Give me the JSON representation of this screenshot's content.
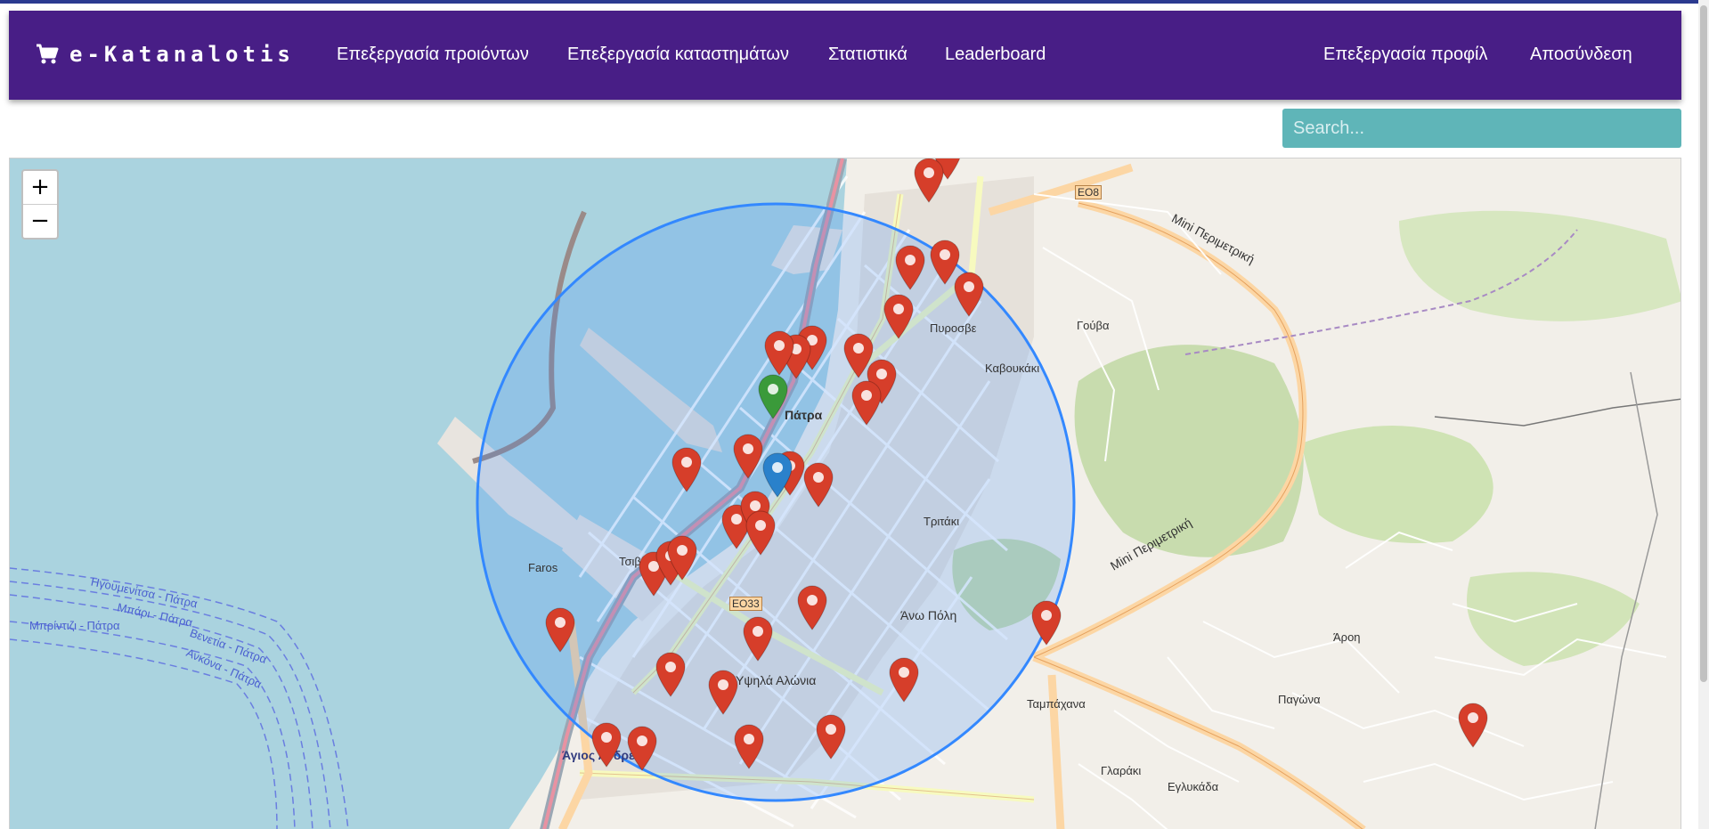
{
  "navbar": {
    "brand": "e-Katanalotis",
    "links": [
      "Επεξεργασία προιόντων",
      "Επεξεργασία καταστημάτων",
      "Στατιστικά",
      "Leaderboard"
    ],
    "right_links": [
      "Επεξεργασία προφίλ",
      "Αποσύνδεση"
    ],
    "brand_icon": "cart-icon"
  },
  "search": {
    "placeholder": "Search..."
  },
  "map": {
    "zoom_in": "+",
    "zoom_out": "−",
    "colors": {
      "store_marker": "#d63e2a",
      "selected_marker": "#3a9a3a",
      "user_marker": "#2a81cb",
      "radius_circle": "#3388ff"
    },
    "labels": {
      "patra": "Πάτρα",
      "agios_andreas": "Άγιος Ανδρέας",
      "ypsila_alonia": "Υψηλά Αλώνια",
      "ano_poli": "Άνω Πόλη",
      "tritaki": "Τριτάκι",
      "kavoukaki": "Καβουκάκι",
      "pyrosvestio": "Πυροσβε",
      "gouva": "Γούβα",
      "tampachana": "Ταμπάχανα",
      "glaraki": "Γλαράκι",
      "eglykada": "Εγλυκάδα",
      "aroi": "Άροη",
      "pagona": "Παγώνα",
      "faros": "Faros",
      "tsivdi": "Τσιβδή",
      "mini_perimetriki": "Μini Περιμετρική",
      "ferry_1": "Ηγουμενίτσα - Πάτρα",
      "ferry_2": "Μπάρι - Πάτρα",
      "ferry_3": "Μπρίντιζι - Πάτρα",
      "ferry_4": "Βενετία - Πάτρα",
      "ferry_5": "Ανκόνα - Πάτρα",
      "e08": "ΕΟ8",
      "e033": "ΕΟ33"
    }
  }
}
